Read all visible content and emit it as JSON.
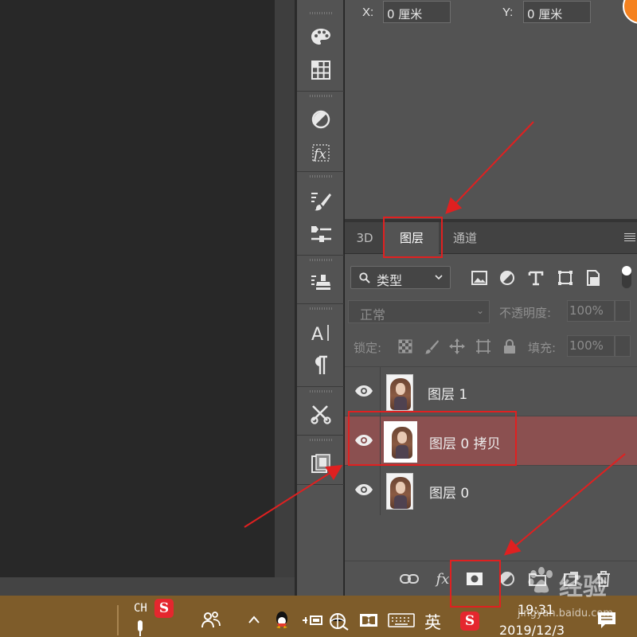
{
  "properties": {
    "x_label": "X:",
    "x_value": "0 厘米",
    "y_label": "Y:",
    "y_value": "0 厘米"
  },
  "layers_panel": {
    "tabs": [
      {
        "label": "3D",
        "active": false
      },
      {
        "label": "图层",
        "active": true
      },
      {
        "label": "通道",
        "active": false
      }
    ],
    "filter": {
      "label": "类型"
    },
    "blend_mode": "正常",
    "opacity_label": "不透明度:",
    "opacity_value": "100%",
    "lock_label": "锁定:",
    "fill_label": "填充:",
    "fill_value": "100%",
    "layers": [
      {
        "name": "图层 1",
        "visible": true,
        "selected": false
      },
      {
        "name": "图层 0 拷贝",
        "visible": true,
        "selected": true
      },
      {
        "name": "图层 0",
        "visible": true,
        "selected": false
      }
    ],
    "bottom_buttons": [
      "link-icon",
      "fx-icon",
      "add-mask-icon",
      "adjustment-icon",
      "group-icon",
      "new-layer-icon",
      "trash-icon"
    ],
    "fx_label": "fx"
  },
  "taskbar": {
    "lang_code": "CH",
    "ime_mode": "英",
    "time": "19:31",
    "date": "2019/12/3",
    "sogou_letter": "S"
  },
  "watermark": {
    "brand": "经验",
    "url": "jingyan.baidu.com"
  },
  "colors": {
    "selected_layer": "#8b5050",
    "annotation_red": "#e02020",
    "taskbar": "#7e5c2a",
    "panel_bg": "#535353"
  }
}
